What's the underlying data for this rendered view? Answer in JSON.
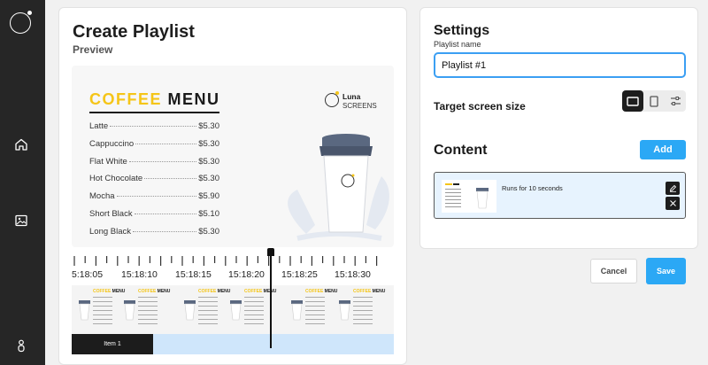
{
  "sidebar": {
    "logo_icon": "app-logo-icon",
    "items": [
      {
        "icon": "home-icon"
      },
      {
        "icon": "image-icon"
      },
      {
        "icon": "user-icon"
      }
    ]
  },
  "create_playlist": {
    "title": "Create Playlist",
    "preview_label": "Preview",
    "preview": {
      "menu_title_word1": "COFFEE",
      "menu_title_word2": "MENU",
      "brand_name": "Luna",
      "brand_sub": "SCREENS",
      "items": [
        {
          "name": "Latte",
          "price": "$5.30"
        },
        {
          "name": "Cappuccino",
          "price": "$5.30"
        },
        {
          "name": "Flat White",
          "price": "$5.30"
        },
        {
          "name": "Hot Chocolate",
          "price": "$5.30"
        },
        {
          "name": "Mocha",
          "price": "$5.90"
        },
        {
          "name": "Short Black",
          "price": "$5.10"
        },
        {
          "name": "Long Black",
          "price": "$5.30"
        }
      ]
    },
    "timeline": {
      "times": [
        "5:18:05",
        "15:18:10",
        "15:18:15",
        "15:18:20",
        "15:18:25",
        "15:18:30"
      ],
      "thumb_title_word1": "COFFEE",
      "thumb_title_word2": "MENU",
      "item_label": "Item 1"
    }
  },
  "settings": {
    "title": "Settings",
    "name_label": "Playlist name",
    "name_value": "Playlist #1",
    "target_label": "Target screen size",
    "size_options": [
      "landscape-icon",
      "portrait-icon",
      "custom-size-icon"
    ],
    "selected_size": "landscape-icon",
    "content_title": "Content",
    "add_label": "Add",
    "content_item": {
      "text": "Runs for 10 seconds"
    }
  },
  "actions": {
    "cancel_label": "Cancel",
    "save_label": "Save"
  },
  "colors": {
    "accent": "#2ba8f5",
    "sidebar": "#262626",
    "coffee_yellow": "#f5c518",
    "timeline_track": "#cfe6fb"
  }
}
